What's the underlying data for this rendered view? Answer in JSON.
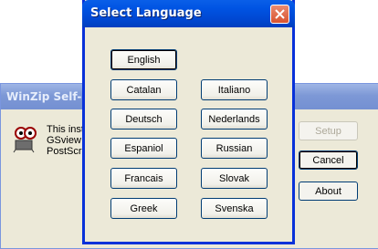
{
  "background_window": {
    "title": "WinZip Self-Ex",
    "text_lines": [
      "This insta",
      "GSview u",
      "PostScrip"
    ],
    "buttons": {
      "setup": "Setup",
      "cancel": "Cancel",
      "about": "About"
    }
  },
  "dialog": {
    "title": "Select Language",
    "languages": [
      "English",
      "Catalan",
      "Italiano",
      "Deutsch",
      "Nederlands",
      "Espaniol",
      "Russian",
      "Francais",
      "Slovak",
      "Greek",
      "Svenska"
    ],
    "selected": "English"
  },
  "colors": {
    "dialog_face": "#ece9d8",
    "titlebar_blue": "#0054e3",
    "close_red": "#d9532f"
  }
}
